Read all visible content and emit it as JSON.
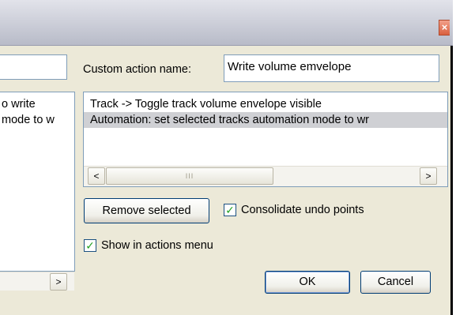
{
  "window": {
    "close_glyph": "×"
  },
  "left_panel": {
    "list_items": [
      "o write",
      "mode to w"
    ],
    "scroll_right_glyph": ">"
  },
  "custom_action": {
    "label": "Custom action name:",
    "value": "Write volume emvelope"
  },
  "actions_list": {
    "items": [
      "Track -> Toggle track volume envelope visible",
      "Automation: set selected tracks automation mode to wr"
    ],
    "selected_index": 1,
    "scroll_left_glyph": "<",
    "scroll_thumb_glyph": "III",
    "scroll_right_glyph": ">"
  },
  "buttons": {
    "remove_selected": "Remove selected",
    "ok": "OK",
    "cancel": "Cancel"
  },
  "checkboxes": {
    "consolidate_undo": {
      "label": "Consolidate undo points",
      "checked": true,
      "mark": "✓"
    },
    "show_in_menu": {
      "label": "Show in actions menu",
      "checked": true,
      "mark": "✓"
    }
  }
}
